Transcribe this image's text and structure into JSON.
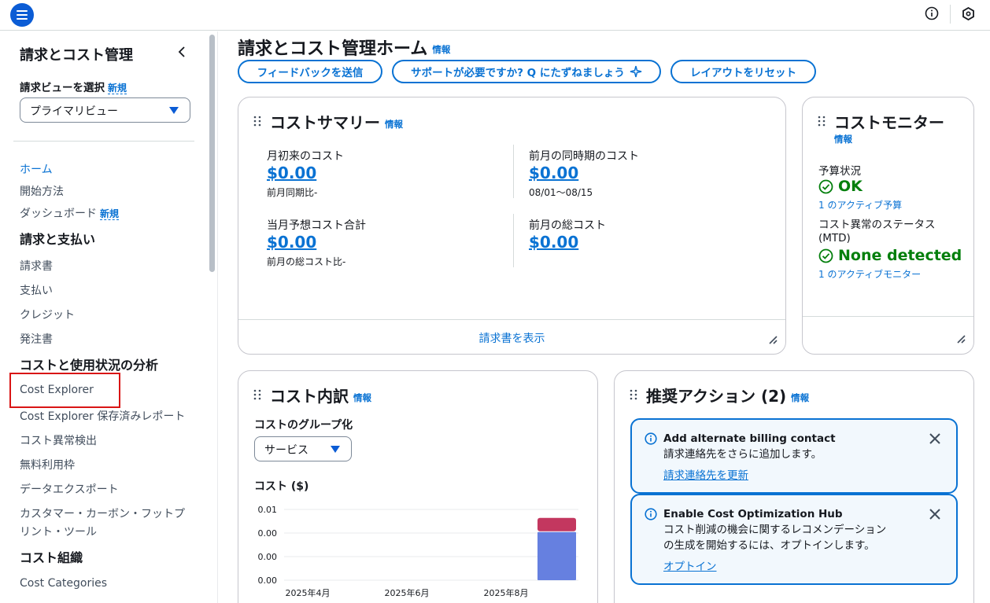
{
  "topbar": {},
  "sidebar": {
    "title": "請求とコスト管理",
    "view_label": "請求ビューを選択",
    "view_new": "新規",
    "view_value": "プライマリビュー",
    "items": [
      {
        "label": "ホーム",
        "active": true
      },
      {
        "label": "開始方法"
      },
      {
        "label": "ダッシュボード",
        "badge": "新規"
      },
      {
        "heading": "請求と支払い"
      },
      {
        "label": "請求書"
      },
      {
        "label": "支払い"
      },
      {
        "label": "クレジット"
      },
      {
        "label": "発注書"
      },
      {
        "heading": "コストと使用状況の分析"
      },
      {
        "label": "Cost Explorer"
      },
      {
        "label": "Cost Explorer 保存済みレポート"
      },
      {
        "label": "コスト異常検出"
      },
      {
        "label": "無料利用枠"
      },
      {
        "label": "データエクスポート"
      },
      {
        "label": "カスタマー・カーボン・フットプ"
      },
      {
        "label": "リント・ツール"
      },
      {
        "heading": "コスト組織"
      },
      {
        "label": "Cost Categories"
      }
    ]
  },
  "main": {
    "title": "請求とコスト管理ホーム",
    "info": "情報",
    "buttons": {
      "feedback": "フィードバックを送信",
      "support": "サポートが必要ですか? Q にたずねましょう",
      "reset": "レイアウトをリセット"
    }
  },
  "cost_summary": {
    "title": "コストサマリー",
    "info": "情報",
    "mtd_label": "月初来のコスト",
    "mtd_value": "$0.00",
    "mtd_sub": "前月同期比-",
    "prev_same_label": "前月の同時期のコスト",
    "prev_same_value": "$0.00",
    "prev_same_sub": "08/01〜08/15",
    "forecast_label": "当月予想コスト合計",
    "forecast_value": "$0.00",
    "forecast_sub": "前月の総コスト比-",
    "prev_total_label": "前月の総コスト",
    "prev_total_value": "$0.00",
    "footer_link": "請求書を表示"
  },
  "cost_monitor": {
    "title": "コストモニター",
    "info": "情報",
    "budget_label": "予算状況",
    "budget_status": "OK",
    "budget_link": "1 のアクティブ予算",
    "anomaly_label_1": "コスト異常のステータス",
    "anomaly_label_2": "(MTD)",
    "anomaly_status": "None detected",
    "anomaly_link": "1 のアクティブモニター"
  },
  "cost_breakdown": {
    "title": "コスト内訳",
    "info": "情報",
    "group_label": "コストのグループ化",
    "group_value": "サービス",
    "chart_title": "コスト ($)"
  },
  "chart_data": {
    "type": "bar",
    "title": "コスト ($)",
    "y_ticks": [
      "0.01",
      "0.00",
      "0.00",
      "0.00"
    ],
    "x_ticks": [
      "2025年4月",
      "2025年6月",
      "2025年8月"
    ],
    "ylim": [
      0,
      0.01
    ],
    "stacked_bar": {
      "category": "2025年8月",
      "segments": [
        {
          "value": 0.0068,
          "color": "#6680e0"
        },
        {
          "value": 0.0019,
          "color": "#c3375f"
        }
      ]
    },
    "grid": true
  },
  "recommended": {
    "title": "推奨アクション (2)",
    "info": "情報",
    "alerts": [
      {
        "title": "Add alternate billing contact",
        "body": [
          "請求連絡先をさらに追加します。"
        ],
        "link": "請求連絡先を更新"
      },
      {
        "title": "Enable Cost Optimization Hub",
        "body": [
          "コスト削減の機会に関するレコメンデーション",
          "の生成を開始するには、オプトインします。"
        ],
        "link": "オプトイン"
      }
    ]
  }
}
